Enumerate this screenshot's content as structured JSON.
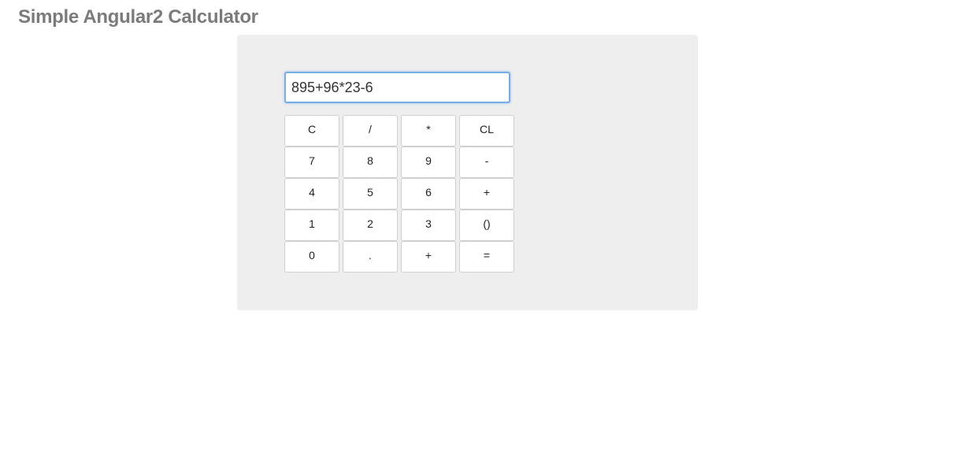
{
  "page": {
    "title": "Simple Angular2 Calculator"
  },
  "calculator": {
    "display_value": "895+96*23-6",
    "rows": [
      [
        {
          "label": "C",
          "name": "clear-button"
        },
        {
          "label": "/",
          "name": "divide-button"
        },
        {
          "label": "*",
          "name": "multiply-button"
        },
        {
          "label": "CL",
          "name": "clear-last-button"
        }
      ],
      [
        {
          "label": "7",
          "name": "digit-7-button"
        },
        {
          "label": "8",
          "name": "digit-8-button"
        },
        {
          "label": "9",
          "name": "digit-9-button"
        },
        {
          "label": "-",
          "name": "subtract-button"
        }
      ],
      [
        {
          "label": "4",
          "name": "digit-4-button"
        },
        {
          "label": "5",
          "name": "digit-5-button"
        },
        {
          "label": "6",
          "name": "digit-6-button"
        },
        {
          "label": "+",
          "name": "add-button"
        }
      ],
      [
        {
          "label": "1",
          "name": "digit-1-button"
        },
        {
          "label": "2",
          "name": "digit-2-button"
        },
        {
          "label": "3",
          "name": "digit-3-button"
        },
        {
          "label": "()",
          "name": "parentheses-button"
        }
      ],
      [
        {
          "label": "0",
          "name": "digit-0-button"
        },
        {
          "label": ".",
          "name": "decimal-button"
        },
        {
          "label": "+",
          "name": "plus-button"
        },
        {
          "label": "=",
          "name": "equals-button"
        }
      ]
    ]
  },
  "colors": {
    "title": "#7b7b7b",
    "panel_background": "#eeeeee",
    "input_focus_border": "#76aee8",
    "key_border": "#cfcfcf"
  }
}
